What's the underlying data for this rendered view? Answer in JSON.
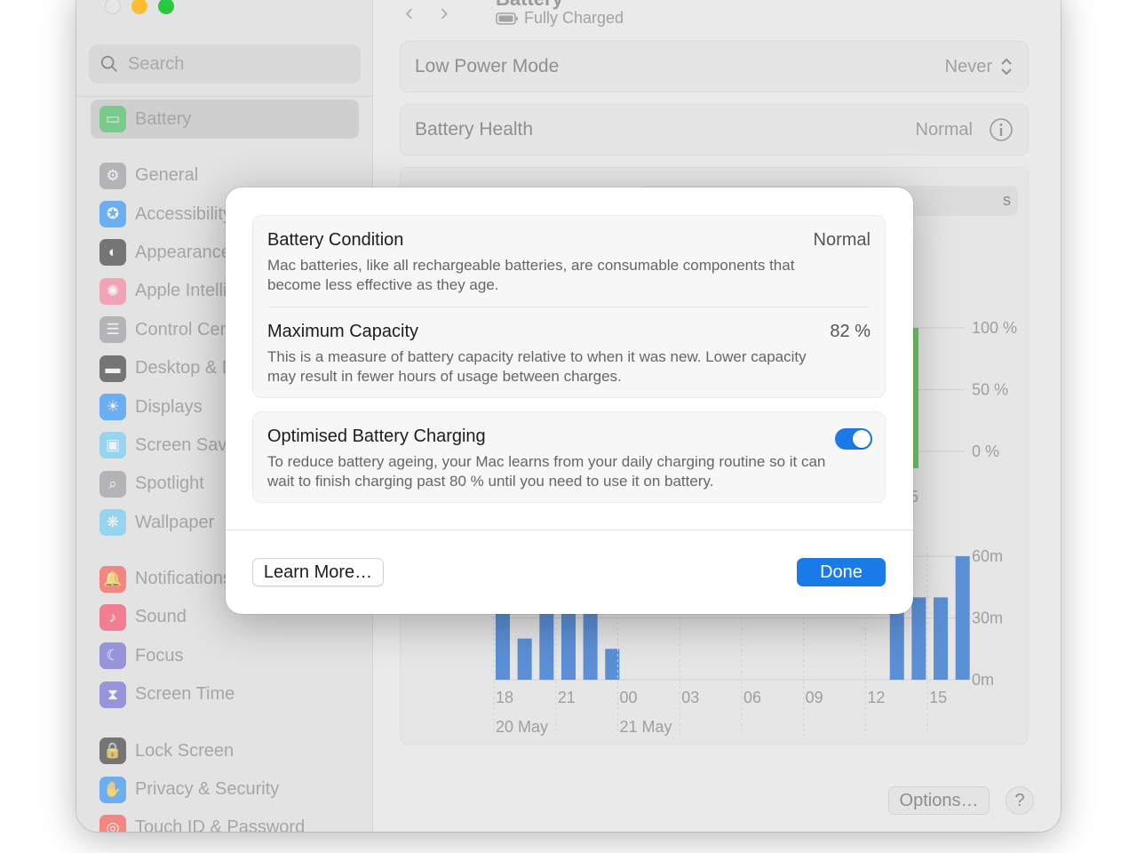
{
  "window": {
    "pane_title": "Battery",
    "pane_subtitle": "Fully Charged"
  },
  "sidebar": {
    "search_placeholder": "Search",
    "items": [
      {
        "label": "Battery",
        "icon": "battery-icon",
        "color": "#34c759",
        "active": true
      },
      {
        "label": "General",
        "icon": "gear-icon",
        "color": "#8e8e93"
      },
      {
        "label": "Accessibility",
        "icon": "accessibility-icon",
        "color": "#0a84ff"
      },
      {
        "label": "Appearance",
        "icon": "appearance-icon",
        "color": "#1c1c1e"
      },
      {
        "label": "Apple Intelligence",
        "icon": "apple-intelligence-icon",
        "color": "#ff6f91"
      },
      {
        "label": "Control Centre",
        "icon": "control-centre-icon",
        "color": "#8e8e93"
      },
      {
        "label": "Desktop & Dock",
        "icon": "desktop-dock-icon",
        "color": "#1c1c1e"
      },
      {
        "label": "Displays",
        "icon": "displays-icon",
        "color": "#0a84ff"
      },
      {
        "label": "Screen Saver",
        "icon": "screen-saver-icon",
        "color": "#5ac8fa"
      },
      {
        "label": "Spotlight",
        "icon": "spotlight-icon",
        "color": "#8e8e93"
      },
      {
        "label": "Wallpaper",
        "icon": "wallpaper-icon",
        "color": "#5ac8fa"
      },
      {
        "label": "Notifications",
        "icon": "notifications-icon",
        "color": "#ff3b30"
      },
      {
        "label": "Sound",
        "icon": "sound-icon",
        "color": "#ff2d55"
      },
      {
        "label": "Focus",
        "icon": "focus-icon",
        "color": "#5856d6"
      },
      {
        "label": "Screen Time",
        "icon": "screen-time-icon",
        "color": "#5856d6"
      },
      {
        "label": "Lock Screen",
        "icon": "lock-icon",
        "color": "#1c1c1e"
      },
      {
        "label": "Privacy & Security",
        "icon": "privacy-hand-icon",
        "color": "#0a84ff"
      },
      {
        "label": "Touch ID & Password",
        "icon": "fingerprint-icon",
        "color": "#ff3b30"
      }
    ]
  },
  "settings": {
    "low_power_label": "Low Power Mode",
    "low_power_value": "Never",
    "battery_health_label": "Battery Health",
    "battery_health_value": "Normal",
    "options_label": "Options…",
    "help_label": "?"
  },
  "chart_data": [
    {
      "type": "bar",
      "name": "battery-level",
      "yticks": [
        "100 %",
        "50 %",
        "0 %"
      ],
      "ylim": [
        0,
        100
      ]
    },
    {
      "type": "bar",
      "name": "screen-on-usage",
      "xticks": [
        "18",
        "21",
        "00",
        "03",
        "06",
        "09",
        "12",
        "15"
      ],
      "date_labels": [
        "20 May",
        "21 May"
      ],
      "yticks": [
        "60m",
        "30m",
        "0m"
      ],
      "ylim": [
        0,
        60
      ],
      "values": [
        40,
        20,
        40,
        40,
        40,
        15,
        0,
        0,
        0,
        0,
        0,
        0,
        0,
        0,
        0,
        0,
        0,
        0,
        40,
        40,
        40,
        60
      ],
      "bar_color": "#5b8fd6"
    }
  ],
  "modal": {
    "condition_title": "Battery Condition",
    "condition_value": "Normal",
    "condition_desc": "Mac batteries, like all rechargeable batteries, are consumable components that become less effective as they age.",
    "capacity_title": "Maximum Capacity",
    "capacity_value": "82 %",
    "capacity_desc": "This is a measure of battery capacity relative to when it was new. Lower capacity may result in fewer hours of usage between charges.",
    "optimised_title": "Optimised Battery Charging",
    "optimised_desc": "To reduce battery ageing, your Mac learns from your daily charging routine so it can wait to finish charging past 80 % until you need to use it on battery.",
    "optimised_enabled": true,
    "learn_more_label": "Learn More…",
    "done_label": "Done",
    "accent_color": "#1a7ae8"
  }
}
